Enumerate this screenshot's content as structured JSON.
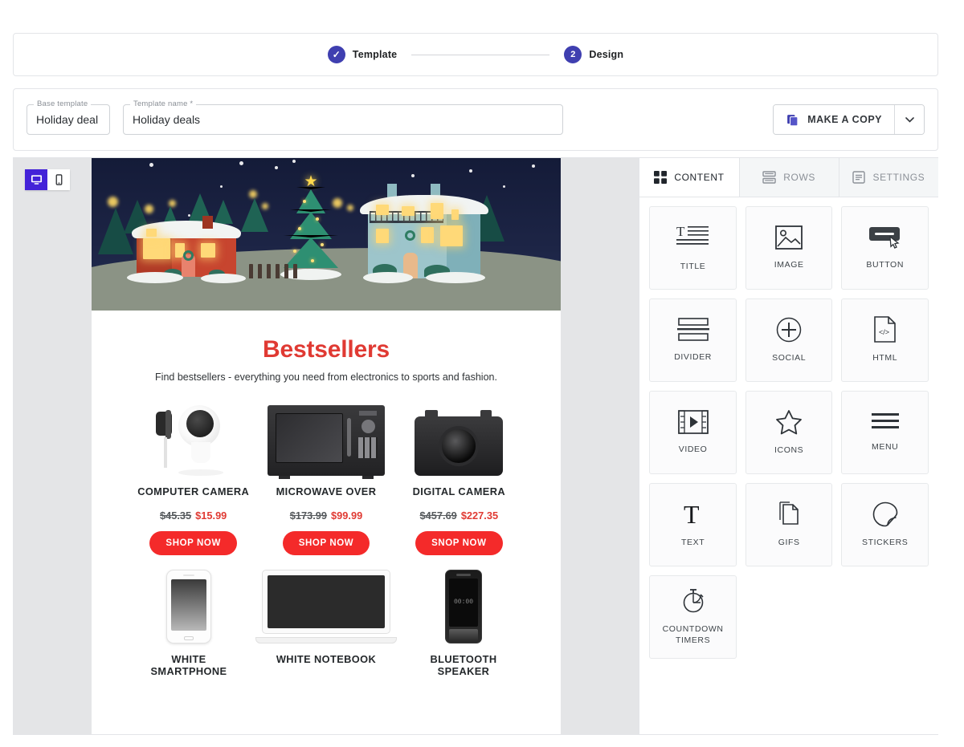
{
  "stepper": {
    "steps": [
      {
        "label": "Template",
        "state": "done",
        "marker": "✓"
      },
      {
        "label": "Design",
        "state": "active",
        "marker": "2"
      }
    ]
  },
  "template_bar": {
    "base_template": {
      "legend": "Base template",
      "value": "Holiday deal"
    },
    "template_name": {
      "legend": "Template name *",
      "value": "Holiday deals",
      "placeholder": "Template name"
    },
    "make_a_copy_label": "MAKE A COPY"
  },
  "canvas": {
    "device_toggle": {
      "desktop": "desktop-view",
      "mobile": "mobile-view",
      "active": "desktop"
    },
    "email": {
      "hero_alt": "christmas-village-illustration",
      "title": "Bestsellers",
      "subtitle": "Find bestsellers - everything you need from electronics to sports and fashion.",
      "products_row1": [
        {
          "name": "COMPUTER CAMERA",
          "old_price": "$45.35",
          "new_price": "$15.99",
          "cta": "SHOP NOW",
          "image": "webcam"
        },
        {
          "name": "MICROWAVE OVER",
          "old_price": "$173.99",
          "new_price": "$99.99",
          "cta": "SHOP NOW",
          "image": "microwave"
        },
        {
          "name": "DIGITAL CAMERA",
          "old_price": "$457.69",
          "new_price": "$227.35",
          "cta": "SNOP NOW",
          "image": "camera"
        }
      ],
      "products_row2": [
        {
          "name": "WHITE SMARTPHONE",
          "image": "white-phone"
        },
        {
          "name": "WHITE NOTEBOOK",
          "image": "laptop"
        },
        {
          "name": "BLUETOOTH SPEAKER",
          "image": "black-phone",
          "screen_text": "00:00"
        }
      ]
    }
  },
  "panel": {
    "tabs": [
      {
        "label": "CONTENT",
        "icon": "grid-icon",
        "active": true
      },
      {
        "label": "ROWS",
        "icon": "rows-icon",
        "active": false
      },
      {
        "label": "SETTINGS",
        "icon": "settings-icon",
        "active": false
      }
    ],
    "tiles": [
      {
        "label": "TITLE",
        "icon": "title-icon"
      },
      {
        "label": "IMAGE",
        "icon": "image-icon"
      },
      {
        "label": "BUTTON",
        "icon": "button-icon"
      },
      {
        "label": "DIVIDER",
        "icon": "divider-icon"
      },
      {
        "label": "SOCIAL",
        "icon": "social-icon"
      },
      {
        "label": "HTML",
        "icon": "html-icon"
      },
      {
        "label": "VIDEO",
        "icon": "video-icon"
      },
      {
        "label": "ICONS",
        "icon": "star-icon"
      },
      {
        "label": "MENU",
        "icon": "menu-icon"
      },
      {
        "label": "TEXT",
        "icon": "text-icon"
      },
      {
        "label": "GIFS",
        "icon": "gifs-icon"
      },
      {
        "label": "STICKERS",
        "icon": "sticker-icon"
      },
      {
        "label": "COUNTDOWN TIMERS",
        "icon": "stopwatch-icon"
      }
    ]
  },
  "colors": {
    "accent_indigo": "#3f3fb0",
    "toggle_active": "#4322d8",
    "promo_red": "#e03a33",
    "button_red": "#f42a2a"
  }
}
